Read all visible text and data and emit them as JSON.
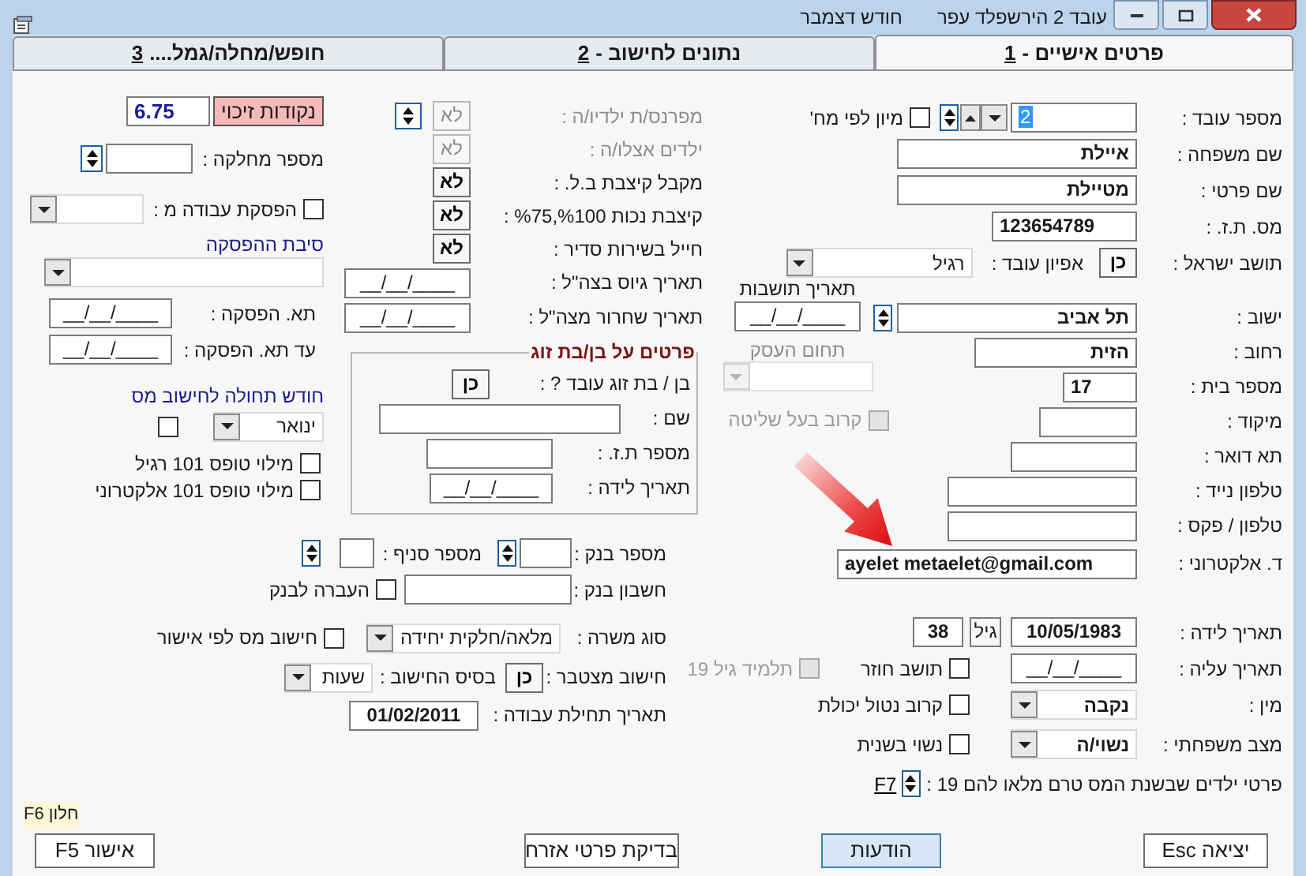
{
  "window": {
    "title": "עובד 2 הירשפלד עפר",
    "month": "חודש דצמבר"
  },
  "tabs": [
    {
      "label": "פרטים אישיים -",
      "hotkey": "1",
      "selected": true
    },
    {
      "label": "נתונים לחישוב -",
      "hotkey": "2",
      "selected": false
    },
    {
      "label": "חופש/מחלה/גמל....",
      "hotkey": "3",
      "selected": false
    }
  ],
  "personal": {
    "employee_number": {
      "label": "מספר עובד :",
      "value": "2",
      "text_selected": true
    },
    "sort_by_department": {
      "label": "מיון לפי מח'",
      "checked": false
    },
    "last_name": {
      "label": "שם משפחה :",
      "value": "איילת"
    },
    "first_name": {
      "label": "שם פרטי :",
      "value": "מטיילת"
    },
    "id_number": {
      "label": "מס. ת.ז. :",
      "value": "123654789"
    },
    "israeli_resident": {
      "label": "תושב ישראל :",
      "value": "כן"
    },
    "employee_type": {
      "label": "אפיון עובד :",
      "value": "רגיל"
    },
    "residency_date": {
      "label": "תאריך תושבות",
      "value": "__/__/____"
    },
    "city": {
      "label": "ישוב :",
      "value": "תל אביב"
    },
    "street": {
      "label": "רחוב :",
      "value": "הזית"
    },
    "business_field": {
      "label": "תחום העסק",
      "disabled": true
    },
    "house_number": {
      "label": "מספר בית :",
      "value": "17"
    },
    "controlling_relative": {
      "label": "קרוב בעל שליטה",
      "checked": false,
      "disabled": true
    },
    "zip": {
      "label": "מיקוד :"
    },
    "po_box": {
      "label": "תא דואר :"
    },
    "mobile": {
      "label": "טלפון נייד :"
    },
    "phone_fax": {
      "label": "טלפון / פקס :"
    },
    "email": {
      "label": "ד. אלקטרוני :",
      "value": "ayelet metaelet@gmail.com"
    },
    "birth_date": {
      "label": "תאריך לידה :",
      "value": "10/05/1983"
    },
    "age": {
      "label": "גיל",
      "value": "38"
    },
    "aliyah_date": {
      "label": "תאריך עליה :",
      "value": "__/__/____"
    },
    "returning_resident": {
      "label": "תושב חוזר",
      "checked": false
    },
    "student_19": {
      "label": "תלמיד גיל 19",
      "checked": false,
      "disabled": true
    },
    "gender": {
      "label": "מין :",
      "value": "נקבה"
    },
    "incapacitated_relative": {
      "label": "קרוב נטול יכולת",
      "checked": false
    },
    "marital_status": {
      "label": "מצב משפחתי :",
      "value": "נשוי/ה"
    },
    "remarried": {
      "label": "נשוי בשנית",
      "checked": false
    },
    "children_under_19": {
      "label": "פרטי ילדים שבשנת המס טרם מלאו להם 19 :",
      "link": "F7"
    }
  },
  "status": [
    {
      "label": "מפרנס/ת ילדיו/ה :",
      "value": "לא",
      "disabled": true
    },
    {
      "label": "ילדים אצלו/ה :",
      "value": "לא",
      "disabled": true
    },
    {
      "label": "מקבל קיצבת ב.ל. :",
      "value": "לא",
      "disabled": false
    },
    {
      "label": "קיצבת נכות %100,%75 :",
      "value": "לא",
      "disabled": false
    },
    {
      "label": "חייל בשירות סדיר :",
      "value": "לא",
      "disabled": false
    }
  ],
  "army_dates": [
    {
      "label": "תאריך גיוס בצה\"ל :",
      "value": "__/__/____"
    },
    {
      "label": "תאריך שחרור מצה\"ל :",
      "value": "__/__/____"
    }
  ],
  "spouse": {
    "title": "פרטים על בן/בת זוג",
    "works": {
      "label": "בן / בת זוג עובד ? :",
      "value": "כן"
    },
    "name": {
      "label": "שם :"
    },
    "id_number": {
      "label": "מספר ת.ז. :"
    },
    "birth_date": {
      "label": "תאריך לידה :",
      "value": "__/__/____"
    }
  },
  "credits": {
    "credit_points": {
      "label": "נקודות זיכוי",
      "value": "6.75"
    },
    "department": {
      "label": "מספר מחלקה :"
    },
    "work_stopped": {
      "label": "הפסקת עבודה מ :",
      "checked": false
    },
    "stop_reason": {
      "label": "סיבת ההפסקה"
    },
    "stop_date": {
      "label": "תא. הפסקה :",
      "value": "__/__/____"
    },
    "stop_until": {
      "label": "עד תא. הפסקה :",
      "value": "__/__/____"
    },
    "tax_month": {
      "label": "חודש תחולה לחישוב מס",
      "value": "ינואר",
      "checked": false
    },
    "form101_regular": {
      "label": "מילוי טופס 101 רגיל",
      "checked": false
    },
    "form101_electronic": {
      "label": "מילוי טופס 101 אלקטרוני",
      "checked": false
    }
  },
  "bank": {
    "bank_number": {
      "label": "מספר בנק :"
    },
    "branch": {
      "label": "מספר סניף :"
    },
    "account": {
      "label": "חשבון בנק :"
    },
    "bank_transfer": {
      "label": "העברה לבנק",
      "checked": false
    },
    "job_type": {
      "label": "סוג משרה :",
      "value": "מלאה/חלקית יחידה"
    },
    "tax_by_approval": {
      "label": "חישוב מס לפי אישור",
      "checked": false
    },
    "cumulative": {
      "label": "חישוב מצטבר :",
      "value": "כן"
    },
    "calc_basis": {
      "label": "בסיס החישוב :",
      "value": "שעות"
    },
    "start_date": {
      "label": "תאריך תחילת עבודה :",
      "value": "01/02/2011"
    }
  },
  "footer": {
    "hint": "חלון F6",
    "buttons": [
      {
        "label": "יציאה Esc",
        "focused": false
      },
      {
        "label": "הודעות",
        "focused": true
      },
      {
        "label": "בדיקת פרטי אזרח",
        "focused": false
      },
      {
        "label": "אישור F5",
        "focused": false
      }
    ]
  }
}
